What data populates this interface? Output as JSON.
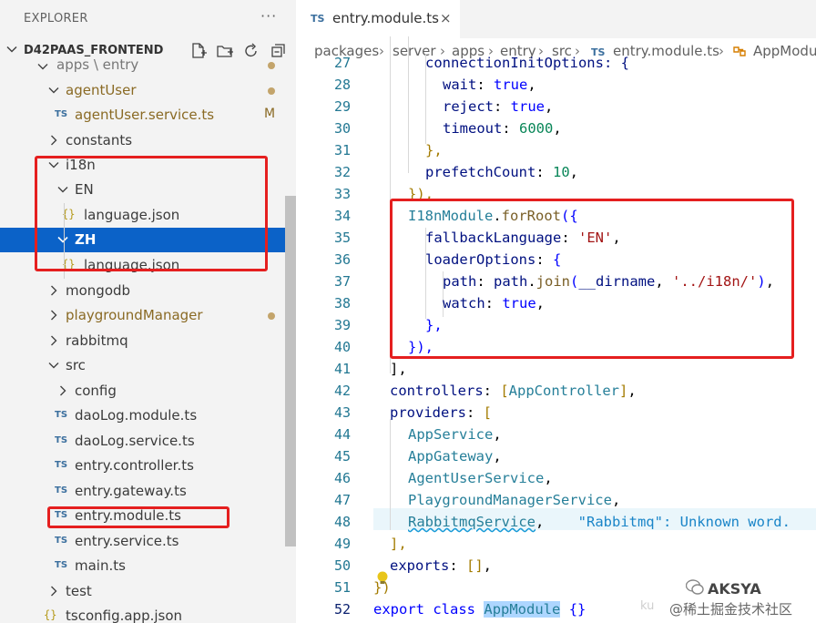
{
  "explorer": {
    "title": "EXPLORER",
    "more": "···",
    "project_name": "D42PAAS_FRONTEND",
    "actions": [
      "new-file-icon",
      "new-folder-icon",
      "refresh-icon",
      "collapse-all-icon"
    ],
    "items": [
      {
        "label": "apps \\ entry",
        "type": "folder",
        "expanded": true,
        "status": "dot"
      },
      {
        "label": "agentUser",
        "type": "folder",
        "expanded": true,
        "status": "dot",
        "modified": true
      },
      {
        "label": "agentUser.service.ts",
        "type": "ts",
        "status": "M",
        "modified": true
      },
      {
        "label": "constants",
        "type": "folder",
        "expanded": false
      },
      {
        "label": "i18n",
        "type": "folder",
        "expanded": true
      },
      {
        "label": "EN",
        "type": "folder",
        "expanded": true
      },
      {
        "label": "language.json",
        "type": "json"
      },
      {
        "label": "ZH",
        "type": "folder",
        "expanded": true,
        "selected": true
      },
      {
        "label": "language.json",
        "type": "json"
      },
      {
        "label": "mongodb",
        "type": "folder",
        "expanded": false
      },
      {
        "label": "playgroundManager",
        "type": "folder",
        "expanded": false,
        "status": "dot",
        "modified": true
      },
      {
        "label": "rabbitmq",
        "type": "folder",
        "expanded": false
      },
      {
        "label": "src",
        "type": "folder",
        "expanded": true
      },
      {
        "label": "config",
        "type": "folder",
        "expanded": false
      },
      {
        "label": "daoLog.module.ts",
        "type": "ts"
      },
      {
        "label": "daoLog.service.ts",
        "type": "ts"
      },
      {
        "label": "entry.controller.ts",
        "type": "ts"
      },
      {
        "label": "entry.gateway.ts",
        "type": "ts"
      },
      {
        "label": "entry.module.ts",
        "type": "ts"
      },
      {
        "label": "entry.service.ts",
        "type": "ts"
      },
      {
        "label": "main.ts",
        "type": "ts"
      },
      {
        "label": "test",
        "type": "folder",
        "expanded": false
      },
      {
        "label": "tsconfig.app.json",
        "type": "json"
      }
    ]
  },
  "tab": {
    "badge": "TS",
    "label": "entry.module.ts",
    "close": "×"
  },
  "breadcrumb": [
    "packages",
    "server",
    "apps",
    "entry",
    "src",
    "entry.module.ts",
    "AppModule"
  ],
  "breadcrumb_sep": "›",
  "breadcrumb_ts": "TS",
  "code": {
    "line_numbers": [
      "27",
      "28",
      "29",
      "30",
      "31",
      "32",
      "33",
      "34",
      "35",
      "36",
      "37",
      "38",
      "39",
      "40",
      "41",
      "42",
      "43",
      "44",
      "45",
      "46",
      "47",
      "48",
      "49",
      "50",
      "51",
      "52"
    ],
    "lines": {
      "l27": "connectionInitOptions: {",
      "l28a": "wait",
      "l28b": "true",
      "l29a": "reject",
      "l29b": "true",
      "l30a": "timeout",
      "l30b": "6000",
      "l31": "},",
      "l32a": "prefetchCount",
      "l32b": "10",
      "l33": "}),",
      "l34a": "I18nModule",
      "l34b": "forRoot",
      "l35a": "fallbackLanguage",
      "l35b": "'EN'",
      "l36a": "loaderOptions",
      "l37a": "path",
      "l37b": "path",
      "l37c": "join",
      "l37d": "__dirname",
      "l37e": "'../i18n/'",
      "l38a": "watch",
      "l38b": "true",
      "l39": "},",
      "l40": "}),",
      "l41": "],",
      "l42a": "controllers",
      "l42b": "AppController",
      "l43a": "providers",
      "l44": "AppService",
      "l45": "AppGateway",
      "l46": "AgentUserService",
      "l47": "PlaygroundManagerService",
      "l48": "RabbitmqService",
      "l48hint": "\"Rabbitmq\": Unknown word.",
      "l49": "],",
      "l50a": "exports",
      "l51": "})",
      "l52a": "export",
      "l52b": "class",
      "l52c": "AppModule"
    }
  },
  "watermark": {
    "brand": "AKSYA",
    "text": "@稀土掘金技术社区",
    "faint": "ku"
  }
}
